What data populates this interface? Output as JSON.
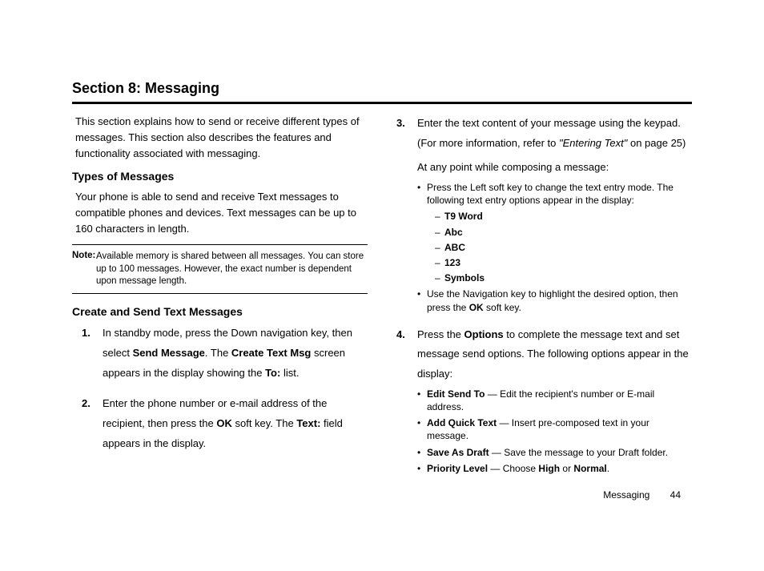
{
  "section_title": "Section 8: Messaging",
  "left": {
    "intro": "This section explains how to send or receive different types of messages. This section also describes the features and functionality associated with messaging.",
    "subhead1": "Types of Messages",
    "types_para": "Your phone is able to send and receive Text messages to compatible phones and devices. Text messages can be up to 160 characters in length.",
    "note_label": "Note:",
    "note_body": "Available memory is shared between all messages. You can store up to 100 messages. However, the exact number is dependent upon message length.",
    "subhead2": "Create and Send Text Messages",
    "step1_a": "In standby mode, press the Down navigation key, then select ",
    "step1_b1": "Send Message",
    "step1_c": ". The ",
    "step1_b2": "Create Text Msg",
    "step1_d": " screen appears in the display showing the ",
    "step1_b3": "To:",
    "step1_e": " list.",
    "step2_a": "Enter the phone number or e-mail address of the recipient, then press the ",
    "step2_b1": "OK",
    "step2_c": " soft key. The ",
    "step2_b2": "Text:",
    "step2_d": " field appears in the display."
  },
  "right": {
    "step3_a": "Enter the text content of your message using the keypad. (For more information, refer to ",
    "step3_i": "\"Entering Text\"",
    "step3_b": "  on page 25)",
    "step3_c": "At any point while composing a message:",
    "sb1": "Press the Left soft key to change the text entry mode. The following text entry options appear in the display:",
    "opt1": "T9 Word",
    "opt2": "Abc",
    "opt3": "ABC",
    "opt4": "123",
    "opt5": "Symbols",
    "sb2_a": "Use the Navigation key to highlight the desired option, then press the ",
    "sb2_b": "OK",
    "sb2_c": " soft key.",
    "step4_a": "Press the ",
    "step4_b": "Options",
    "step4_c": " to complete the message text and set message send options. The following options appear in the display:",
    "o1b": "Edit Send To",
    "o1t": " — Edit the recipient's number or E-mail address.",
    "o2b": "Add Quick Text",
    "o2t": " — Insert pre-composed text in your message.",
    "o3b": "Save As Draft",
    "o3t": " — Save the message to your Draft folder.",
    "o4b": "Priority Level",
    "o4t_a": " — Choose ",
    "o4t_b1": "High",
    "o4t_c": " or ",
    "o4t_b2": "Normal",
    "o4t_d": "."
  },
  "footer": {
    "section": "Messaging",
    "page": "44"
  }
}
